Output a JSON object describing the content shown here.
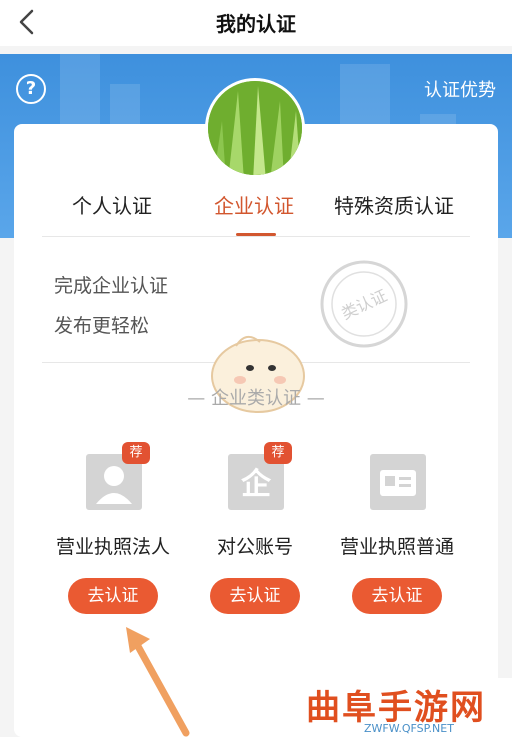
{
  "header": {
    "back_icon": "chevron-left-icon",
    "title": "我的认证"
  },
  "banner": {
    "help_icon": "question-circle-icon",
    "help_glyph": "?",
    "advantage_label": "认证优势"
  },
  "tabs": [
    {
      "label": "个人认证",
      "active": false
    },
    {
      "label": "企业认证",
      "active": true
    },
    {
      "label": "特殊资质认证",
      "active": false
    }
  ],
  "intro": {
    "line1": "完成企业认证",
    "line2": "发布更轻松"
  },
  "stamp_text": "类认证",
  "section_title": "— 企业类认证 —",
  "options": [
    {
      "label": "营业执照法人",
      "badge": "荐",
      "button": "去认证",
      "icon": "person-id-icon"
    },
    {
      "label": "对公账号",
      "badge": "荐",
      "button": "去认证",
      "icon": "enterprise-icon"
    },
    {
      "label": "营业执照普通",
      "badge": "",
      "button": "去认证",
      "icon": "id-card-icon"
    }
  ],
  "watermark": {
    "title": "曲阜手游网",
    "url": "ZWFW.QFSP.NET"
  },
  "colors": {
    "accent": "#ea5a32",
    "active_tab": "#d2572f",
    "banner": "#4a9ae4"
  }
}
